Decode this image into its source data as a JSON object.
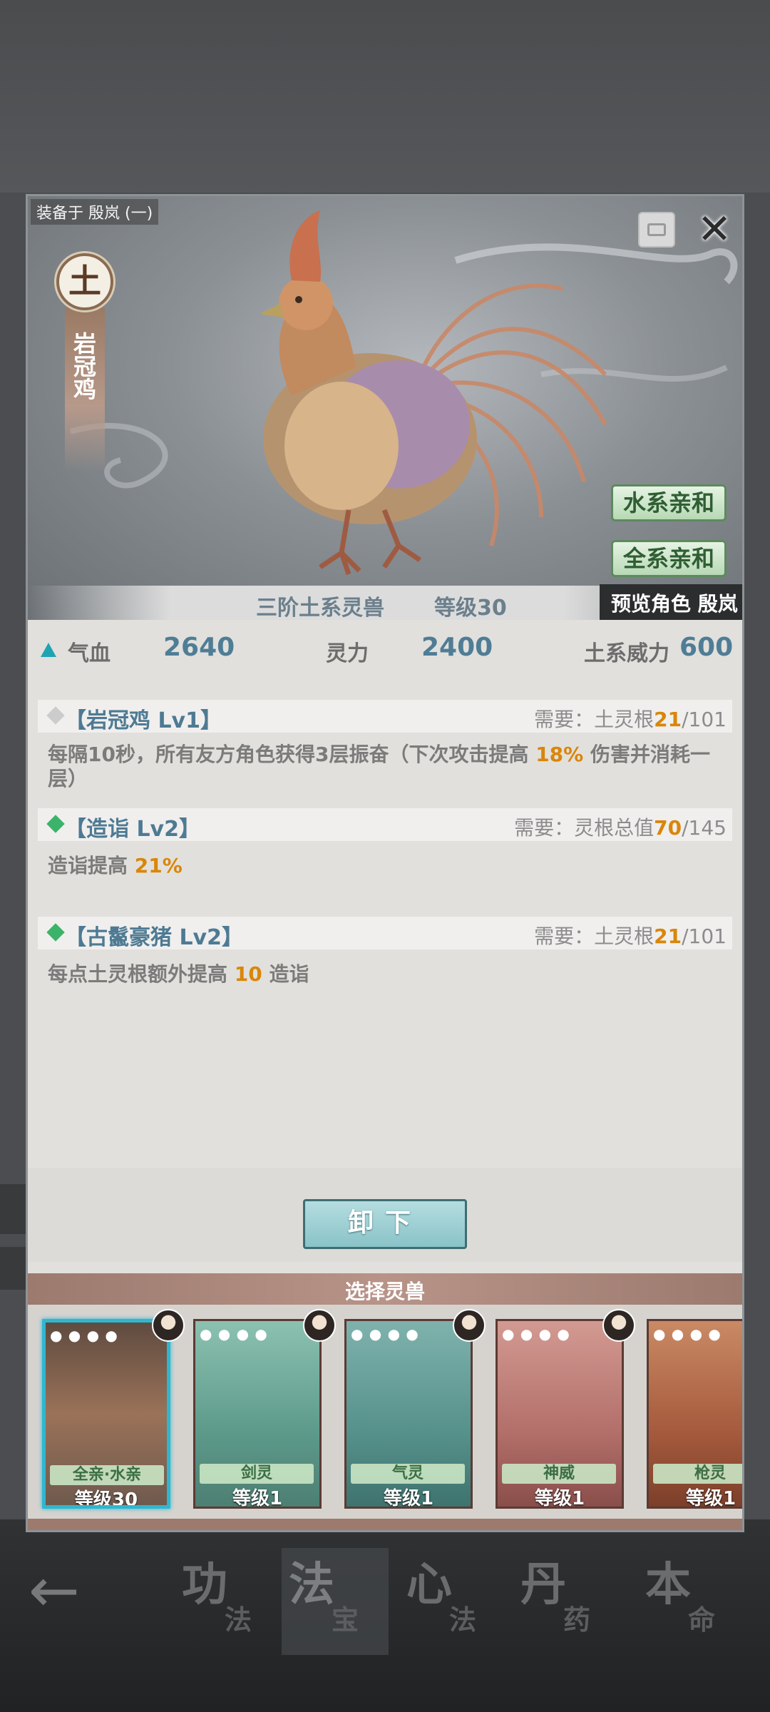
{
  "background": {
    "back_icon": "back-arrow-icon",
    "nav_tabs": [
      {
        "big": "功",
        "small": "法"
      },
      {
        "big": "法",
        "small": "宝"
      },
      {
        "big": "心",
        "small": "法"
      },
      {
        "big": "丹",
        "small": "药"
      },
      {
        "big": "本",
        "small": "命"
      }
    ]
  },
  "panel": {
    "equipped_label": "装备于 殷岚 (一)",
    "close_icon": "close-x-icon",
    "lock_icon": "lock-icon",
    "element": "土",
    "beast_name": "岩冠鸡",
    "affinity": [
      "水系亲和",
      "全系亲和"
    ],
    "tier": "三阶土系灵兽",
    "level": "等级30",
    "preview": "预览角色 殷岚"
  },
  "stats": [
    {
      "label": "气血",
      "value": "2640"
    },
    {
      "label": "灵力",
      "value": "2400"
    },
    {
      "label": "土系威力",
      "value": "600"
    }
  ],
  "skills": [
    {
      "name": "【岩冠鸡 Lv1】",
      "req_prefix": "需要：土灵根",
      "req_current": "21",
      "req_total": "/101",
      "desc_pre": "每隔10秒，所有友方角色获得3层振奋（下次攻击提高 ",
      "desc_hl": "18%",
      "desc_post": " 伤害并消耗一",
      "desc_line2": "层）",
      "diamond": "#cccccc"
    },
    {
      "name": "【造诣 Lv2】",
      "req_prefix": "需要：灵根总值",
      "req_current": "70",
      "req_total": "/145",
      "desc_pre": "造诣提高 ",
      "desc_hl": "21%",
      "diamond": "#3cb36a"
    },
    {
      "name": "【古鬣豪猪 Lv2】",
      "req_prefix": "需要：土灵根",
      "req_current": "21",
      "req_total": "/101",
      "desc_pre": "每点土灵根额外提高 ",
      "desc_hl": "10",
      "desc_post": " 造诣",
      "diamond": "#3cb36a"
    }
  ],
  "unequip_label": "卸下",
  "select_title": "选择灵兽",
  "cards": [
    {
      "label": "全亲·水亲",
      "level": "等级30",
      "paws": "● ● ● ●",
      "selected": true,
      "color": "#7b6656"
    },
    {
      "label": "剑灵",
      "level": "等级1",
      "paws": "● ● ● ●",
      "selected": false,
      "color": "#6fa79a"
    },
    {
      "label": "气灵",
      "level": "等级1",
      "paws": "● ● ● ●",
      "selected": false,
      "color": "#5f9a96"
    },
    {
      "label": "神威",
      "level": "等级1",
      "paws": "● ● ● ●",
      "selected": false,
      "color": "#b87a76"
    },
    {
      "label": "枪灵",
      "level": "等级1",
      "paws": "● ● ● ●",
      "selected": false,
      "color": "#b46a4c"
    }
  ],
  "colors": {
    "accent_teal": "#2fb7d0",
    "highlight_orange": "#d9860a",
    "affinity_green": "#2f5e33",
    "value_blue": "#4f7d96"
  }
}
